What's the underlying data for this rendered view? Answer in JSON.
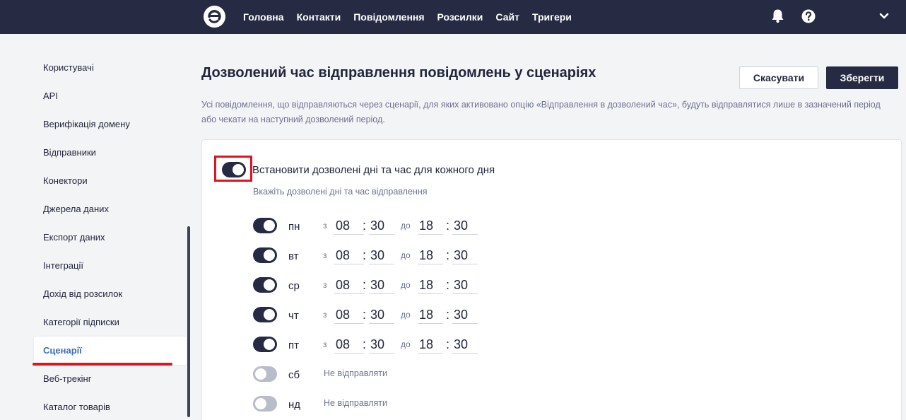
{
  "nav": {
    "items": [
      "Головна",
      "Контакти",
      "Повідомлення",
      "Розсилки",
      "Сайт",
      "Тригери"
    ]
  },
  "sidebar": {
    "items": [
      {
        "label": "Користувачі"
      },
      {
        "label": "API"
      },
      {
        "label": "Верифікація домену"
      },
      {
        "label": "Відправники"
      },
      {
        "label": "Конектори"
      },
      {
        "label": "Джерела даних"
      },
      {
        "label": "Експорт даних"
      },
      {
        "label": "Інтеграції"
      },
      {
        "label": "Дохід від розсилок"
      },
      {
        "label": "Категорії підписки"
      },
      {
        "label": "Сценарії"
      },
      {
        "label": "Веб-трекінг"
      },
      {
        "label": "Каталог товарів"
      }
    ],
    "active_index": 10
  },
  "page": {
    "title": "Дозволений час відправлення повідомлень у сценаріях",
    "cancel_label": "Скасувати",
    "save_label": "Зберегти",
    "description": "Усі повідомлення, що відправляються через сценарії, для яких активовано опцію «Відправлення в дозволений час», будуть відправлятися лише в зазначений період або чекати на наступний дозволений період."
  },
  "settings": {
    "main_toggle_on": true,
    "main_label": "Встановити дозволені дні та час для кожного дня",
    "main_subtitle": "Вкажіть дозволені дні та час відправлення",
    "from_label": "з",
    "to_label": "до",
    "no_send_label": "Не відправляти",
    "days": [
      {
        "day": "пн",
        "enabled": true,
        "from_h": "08",
        "from_m": "30",
        "to_h": "18",
        "to_m": "30"
      },
      {
        "day": "вт",
        "enabled": true,
        "from_h": "08",
        "from_m": "30",
        "to_h": "18",
        "to_m": "30"
      },
      {
        "day": "ср",
        "enabled": true,
        "from_h": "08",
        "from_m": "30",
        "to_h": "18",
        "to_m": "30"
      },
      {
        "day": "чт",
        "enabled": true,
        "from_h": "08",
        "from_m": "30",
        "to_h": "18",
        "to_m": "30"
      },
      {
        "day": "пт",
        "enabled": true,
        "from_h": "08",
        "from_m": "30",
        "to_h": "18",
        "to_m": "30"
      },
      {
        "day": "сб",
        "enabled": false
      },
      {
        "day": "нд",
        "enabled": false
      }
    ]
  },
  "colors": {
    "header_bg": "#262b43",
    "accent_link": "#3b6fb6",
    "highlight_red": "#e0141e"
  },
  "icons": [
    "logo-icon",
    "bell-icon",
    "help-icon",
    "chevron-down-icon"
  ]
}
